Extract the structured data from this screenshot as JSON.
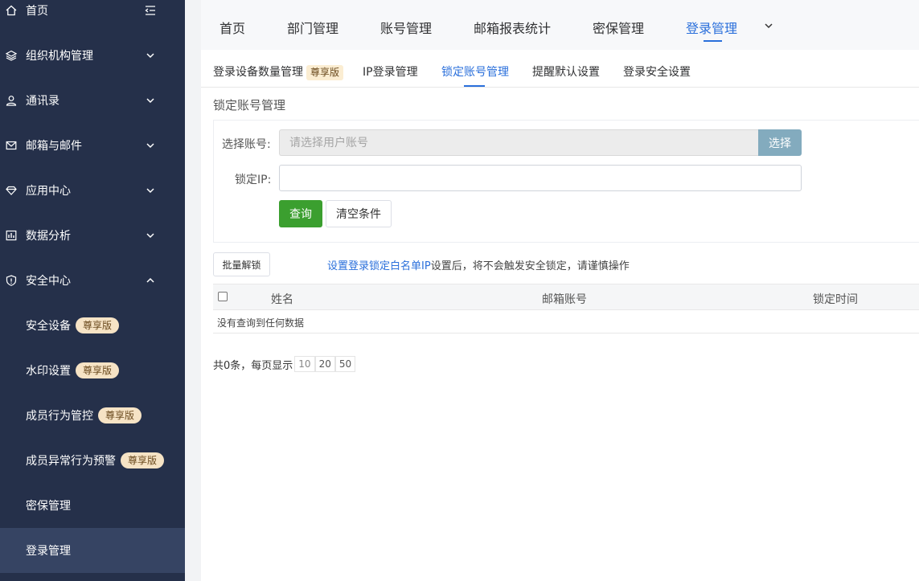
{
  "sidebar": {
    "items": [
      {
        "label": "首页",
        "icon": "home-icon"
      },
      {
        "label": "组织机构管理",
        "icon": "layers-icon"
      },
      {
        "label": "通讯录",
        "icon": "user-icon"
      },
      {
        "label": "邮箱与邮件",
        "icon": "mail-icon"
      },
      {
        "label": "应用中心",
        "icon": "diamond-icon"
      },
      {
        "label": "数据分析",
        "icon": "chart-icon"
      },
      {
        "label": "安全中心",
        "icon": "shield-icon"
      }
    ],
    "security_sub": [
      {
        "label": "安全设备",
        "badge": "尊享版"
      },
      {
        "label": "水印设置",
        "badge": "尊享版"
      },
      {
        "label": "成员行为管控",
        "badge": "尊享版"
      },
      {
        "label": "成员异常行为预警",
        "badge": "尊享版"
      },
      {
        "label": "密保管理"
      },
      {
        "label": "登录管理"
      }
    ]
  },
  "topnav": {
    "tabs": [
      "首页",
      "部门管理",
      "账号管理",
      "邮箱报表统计",
      "密保管理",
      "登录管理"
    ],
    "active": "登录管理"
  },
  "subtabs": {
    "items": [
      "登录设备数量管理",
      "IP登录管理",
      "锁定账号管理",
      "提醒默认设置",
      "登录安全设置"
    ],
    "badge": "尊享版",
    "active": "锁定账号管理"
  },
  "page": {
    "title": "锁定账号管理",
    "account_label": "选择账号:",
    "account_placeholder": "请选择用户账号",
    "pick_button": "选择",
    "ip_label": "锁定IP:",
    "ip_value": "",
    "query_button": "查询",
    "clear_button": "清空条件",
    "batch_unlock": "批量解锁",
    "notice_link": "设置登录锁定白名单IP",
    "notice_text": "设置后，将不会触发安全锁定，请谨慎操作"
  },
  "table": {
    "columns": [
      "姓名",
      "邮箱账号",
      "锁定时间"
    ],
    "empty_text": "没有查询到任何数据"
  },
  "pager": {
    "summary": "共0条，每页显示",
    "sizes": [
      "10",
      "20",
      "50"
    ],
    "current": "10"
  },
  "colors": {
    "sidebar_bg": "#25304a",
    "accent": "#2a6fdb",
    "query_green": "#3b9f2f",
    "badge_bg": "#f6e3c5"
  }
}
